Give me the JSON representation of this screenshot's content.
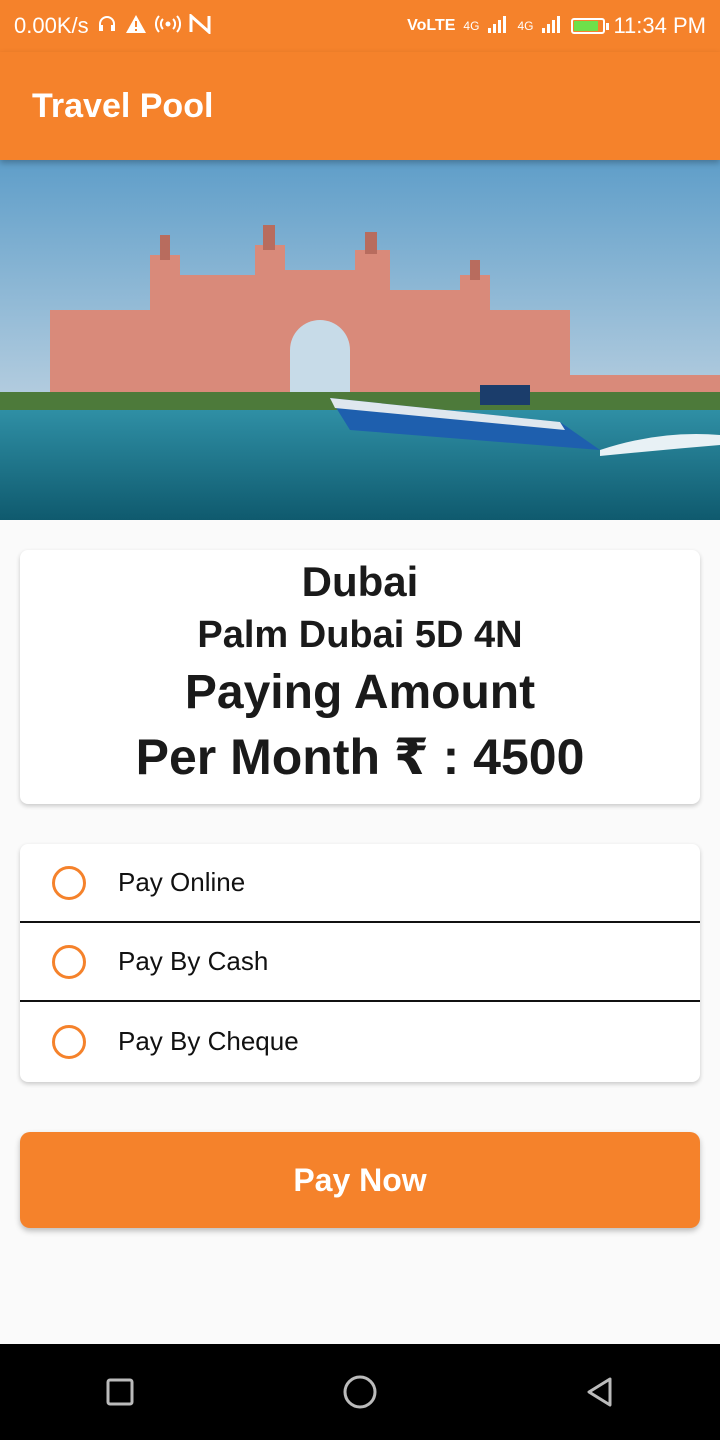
{
  "status_bar": {
    "network_speed": "0.00K/s",
    "network_label": "VoLTE",
    "signal_label_1": "4G",
    "signal_label_2": "4G",
    "time": "11:34 PM",
    "icons": [
      "headphones-icon",
      "warning-icon",
      "hotspot-icon",
      "n-icon",
      "signal-icon",
      "battery-icon"
    ],
    "battery_level": 0.85
  },
  "app_bar": {
    "title": "Travel Pool",
    "color": "#f5822b"
  },
  "trip": {
    "city": "Dubai",
    "package": "Palm Dubai 5D 4N",
    "amount_label": "Paying Amount",
    "amount": "Per Month ₹ : 4500"
  },
  "payment_options": [
    {
      "label": "Pay Online",
      "selected": false
    },
    {
      "label": "Pay By Cash",
      "selected": false
    },
    {
      "label": "Pay By Cheque",
      "selected": false
    }
  ],
  "pay_button": {
    "label": "Pay Now"
  },
  "nav_bar": {
    "icons": [
      "recent-apps-icon",
      "home-icon",
      "back-icon"
    ]
  }
}
